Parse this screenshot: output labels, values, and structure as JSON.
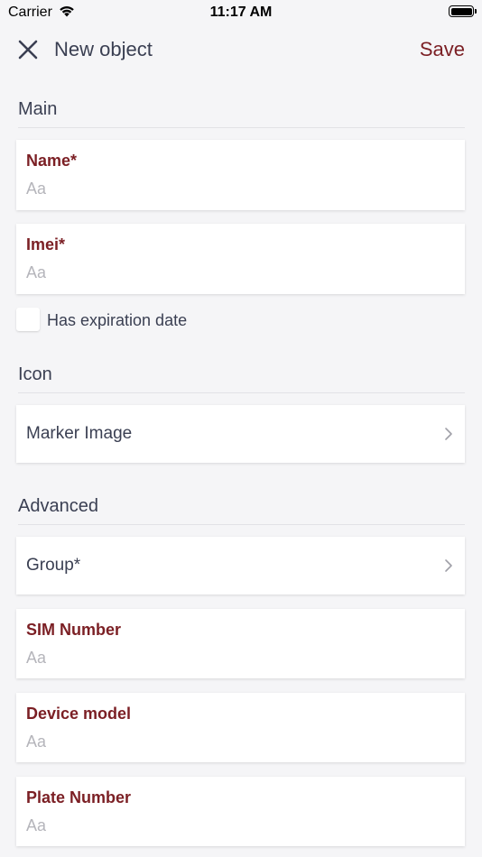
{
  "status_bar": {
    "carrier": "Carrier",
    "time": "11:17 AM"
  },
  "nav": {
    "title": "New object",
    "save_label": "Save"
  },
  "sections": {
    "main": "Main",
    "icon": "Icon",
    "advanced": "Advanced"
  },
  "fields": {
    "name": {
      "label": "Name*",
      "placeholder": "Aa"
    },
    "imei": {
      "label": "Imei*",
      "placeholder": "Aa"
    },
    "sim_number": {
      "label": "SIM Number",
      "placeholder": "Aa"
    },
    "device_model": {
      "label": "Device model",
      "placeholder": "Aa"
    },
    "plate_number": {
      "label": "Plate Number",
      "placeholder": "Aa"
    }
  },
  "expiration": {
    "label": "Has expiration date",
    "checked": false
  },
  "rows": {
    "marker_image": "Marker Image",
    "group": "Group*"
  },
  "colors": {
    "accent": "#7b1f24",
    "text": "#3a3f52",
    "placeholder": "#b5b5bb",
    "background": "#f5f5f7"
  }
}
